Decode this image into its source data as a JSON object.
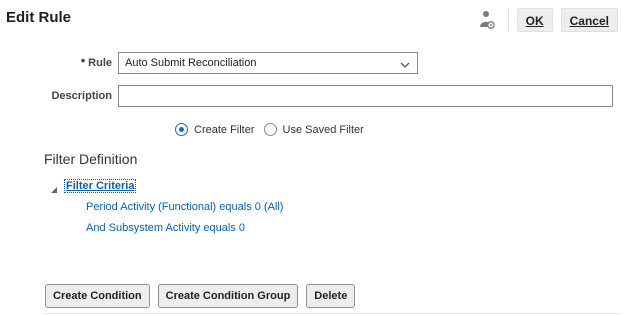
{
  "header": {
    "title": "Edit Rule",
    "ok_label": "OK",
    "cancel_label": "Cancel",
    "person_icon": "person-settings-icon"
  },
  "form": {
    "rule": {
      "required_marker": "*",
      "label": "Rule",
      "selected": "Auto Submit Reconciliation"
    },
    "description": {
      "label": "Description",
      "value": "",
      "placeholder": ""
    },
    "filter_mode": {
      "options": [
        {
          "label": "Create Filter",
          "checked": true
        },
        {
          "label": "Use Saved Filter",
          "checked": false
        }
      ]
    }
  },
  "filter_definition": {
    "title": "Filter Definition",
    "root_label": "Filter Criteria",
    "expanded": true,
    "conditions": [
      "Period Activity (Functional) equals 0 (All)",
      "And Subsystem Activity equals 0"
    ]
  },
  "actions": {
    "create_condition": "Create Condition",
    "create_condition_group": "Create Condition Group",
    "delete": "Delete"
  },
  "colors": {
    "link": "#0b61a4",
    "radio_selected": "#1d6bb6",
    "button_bg": "#ededed"
  }
}
